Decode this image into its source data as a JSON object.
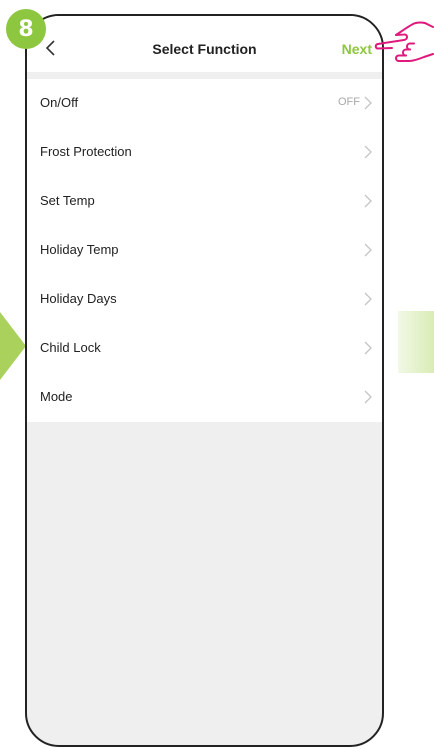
{
  "step": {
    "number": "8"
  },
  "header": {
    "back_icon": "chevron-left-icon",
    "title": "Select Function",
    "next_label": "Next"
  },
  "functions": [
    {
      "label": "On/Off",
      "value": "OFF"
    },
    {
      "label": "Frost Protection",
      "value": ""
    },
    {
      "label": "Set Temp",
      "value": ""
    },
    {
      "label": "Holiday Temp",
      "value": ""
    },
    {
      "label": "Holiday Days",
      "value": ""
    },
    {
      "label": "Child Lock",
      "value": ""
    },
    {
      "label": "Mode",
      "value": ""
    }
  ],
  "colors": {
    "accent_green": "#8dc63f",
    "pointer_pink": "#e0197d",
    "page_background": "#efefef"
  }
}
